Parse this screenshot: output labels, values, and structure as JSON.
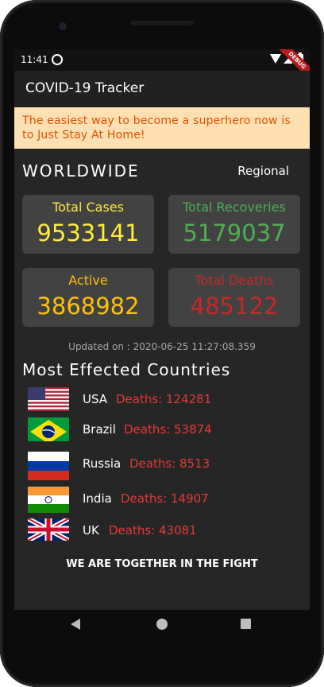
{
  "status": {
    "time": "11:41",
    "debug_label": "DEBUG"
  },
  "appbar": {
    "title": "COVID-19 Tracker"
  },
  "banner": {
    "text": "The easiest way to become a superhero now is to Just Stay At Home!"
  },
  "header": {
    "worldwide": "WORLDWIDE",
    "regional": "Regional"
  },
  "stats": {
    "total_cases": {
      "label": "Total Cases",
      "value": "9533141"
    },
    "total_recoveries": {
      "label": "Total Recoveries",
      "value": "5179037"
    },
    "active": {
      "label": "Active",
      "value": "3868982"
    },
    "total_deaths": {
      "label": "Total Deaths",
      "value": "485122"
    }
  },
  "updated": "Updated on : 2020-06-25 11:27:08.359",
  "countries_title": "Most Effected Countries",
  "countries": [
    {
      "name": "USA",
      "deaths": "Deaths: 124281",
      "flag": "us-flag"
    },
    {
      "name": "Brazil",
      "deaths": "Deaths: 53874",
      "flag": "brazil-flag"
    },
    {
      "name": "Russia",
      "deaths": "Deaths: 8513",
      "flag": "russia-flag"
    },
    {
      "name": "India",
      "deaths": "Deaths: 14907",
      "flag": "india-flag"
    },
    {
      "name": "UK",
      "deaths": "Deaths: 43081",
      "flag": "uk-flag"
    }
  ],
  "footer": "WE ARE TOGETHER IN THE FIGHT",
  "colors": {
    "banner_bg": "#ffe0b2",
    "banner_text": "#e65100",
    "cases": "#ffeb3b",
    "recoveries": "#4caf50",
    "active": "#ffc107",
    "deaths": "#c62828"
  }
}
